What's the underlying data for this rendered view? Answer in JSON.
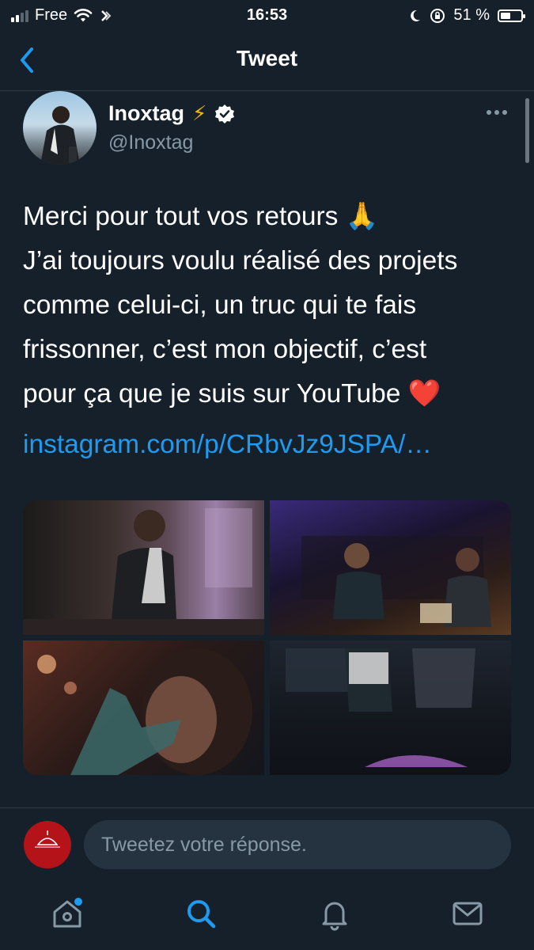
{
  "status_bar": {
    "carrier": "Free",
    "time": "16:53",
    "battery_percent": "51 %",
    "battery_level": 0.51
  },
  "nav": {
    "title": "Tweet",
    "back_icon": "chevron-left-icon"
  },
  "tweet": {
    "author_name": "Inoxtag",
    "author_emoji": "⚡",
    "verified": true,
    "handle": "@Inoxtag",
    "text_lines": [
      "Merci pour tout vos retours 🙏",
      "J’ai toujours voulu réalisé des projets",
      "comme celui-ci, un truc qui te fais",
      "frissonner, c’est mon objectif, c’est",
      "pour ça que je suis sur YouTube ❤️"
    ],
    "link": "instagram.com/p/CRbvJz9JSPA/…",
    "media_count": 4
  },
  "reply": {
    "placeholder": "Tweetez votre réponse."
  },
  "tabs": [
    {
      "name": "home",
      "icon": "home-icon",
      "has_notification_dot": true
    },
    {
      "name": "search",
      "icon": "search-icon",
      "active": true
    },
    {
      "name": "notifications",
      "icon": "bell-icon"
    },
    {
      "name": "messages",
      "icon": "mail-icon"
    }
  ],
  "colors": {
    "background": "#15202b",
    "accent": "#1d9bf0",
    "muted": "#8899a6"
  }
}
